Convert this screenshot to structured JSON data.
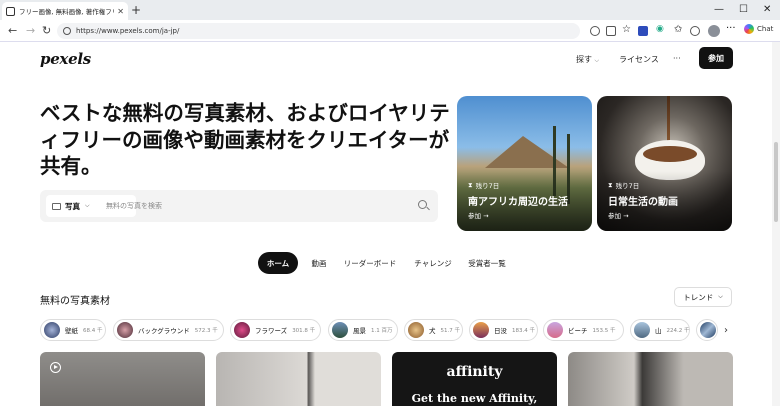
{
  "browser": {
    "tab_title": "フリー画像, 無料画像, 著作権フリーE",
    "tab_close": "✕",
    "new_tab": "+",
    "url": "https://www.pexels.com/ja-jp/",
    "chat_label": "Chat",
    "win_minimize": "—",
    "win_maximize": "☐",
    "win_close": "✕"
  },
  "header": {
    "logo": "pexels",
    "explore_label": "探す",
    "license_label": "ライセンス",
    "more_label": "···",
    "join_label": "参加"
  },
  "hero": {
    "headline": "ベストな無料の写真素材、およびロイヤリティフリーの画像や動画素材をクリエイターが共有。",
    "search": {
      "type_label": "写真",
      "placeholder": "無料の写真を検索"
    }
  },
  "challenges": [
    {
      "days_left": "残り7日",
      "title": "南アフリカ周辺の生活",
      "link": "参加 →"
    },
    {
      "days_left": "残り7日",
      "title": "日常生活の動画",
      "link": "参加 →"
    }
  ],
  "tabs": [
    {
      "label": "ホーム",
      "active": true
    },
    {
      "label": "動画",
      "active": false
    },
    {
      "label": "リーダーボード",
      "active": false
    },
    {
      "label": "チャレンジ",
      "active": false
    },
    {
      "label": "受賞者一覧",
      "active": false
    }
  ],
  "section": {
    "title": "無料の写真素材",
    "sort_label": "トレンド"
  },
  "categories": [
    {
      "label": "壁紙",
      "count": "68.4 千"
    },
    {
      "label": "バックグラウンド",
      "count": "572.3 千"
    },
    {
      "label": "フラワーズ",
      "count": "301.8 千"
    },
    {
      "label": "風景",
      "count": "1.1 百万"
    },
    {
      "label": "犬",
      "count": "51.7 千"
    },
    {
      "label": "日没",
      "count": "183.4 千"
    },
    {
      "label": "ビーチ",
      "count": "153.5 千"
    },
    {
      "label": "山",
      "count": "224.2 千"
    }
  ],
  "ad": {
    "brand": "affinity",
    "tagline": "Get the new Affinity,"
  },
  "colors": {
    "accent": "#111111",
    "page_bg": "#ffffff"
  }
}
